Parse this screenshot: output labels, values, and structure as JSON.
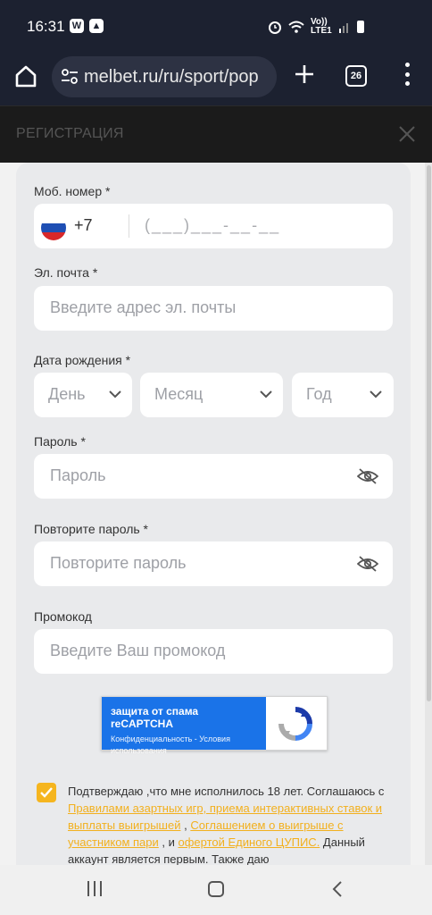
{
  "status_bar": {
    "time": "16:31",
    "left_icons": [
      "whatsapp-icon",
      "gallery-icon"
    ],
    "network_label": "Vo)) LTE1",
    "right_icons": [
      "alarm-icon",
      "wifi-icon",
      "signal-icon",
      "battery-icon"
    ]
  },
  "browser": {
    "url": "melbet.ru/ru/sport/pop",
    "tab_count": "26"
  },
  "modal": {
    "title": "РЕГИСТРАЦИЯ"
  },
  "form": {
    "phone": {
      "label": "Моб. номер *",
      "country_code": "+7",
      "placeholder": "(___)___-__-__"
    },
    "email": {
      "label": "Эл. почта *",
      "placeholder": "Введите адрес эл. почты"
    },
    "birth_date": {
      "label": "Дата рождения *",
      "day": "День",
      "month": "Месяц",
      "year": "Год"
    },
    "password": {
      "label": "Пароль *",
      "placeholder": "Пароль"
    },
    "password_repeat": {
      "label": "Повторите пароль *",
      "placeholder": "Повторите пароль"
    },
    "promo": {
      "label": "Промокод",
      "placeholder": "Введите Ваш промокод"
    }
  },
  "captcha": {
    "title": "защита от спама reCAPTCHA",
    "privacy": "Конфиденциальность",
    "separator": " - ",
    "terms": "Условия использования"
  },
  "consent": {
    "checked": true,
    "text_1": "Подтверждаю ,что мне исполнилось 18 лет. Соглашаюсь с ",
    "link_1": "Правилами азартных игр, приема интерактивных ставок и выплаты выигрышей",
    "text_2": " , ",
    "link_2": "Соглашением о выигрыше с участником пари",
    "text_3": " , и ",
    "link_3": "офертой Единого ЦУПИС.",
    "text_4": " Данный аккаунт является первым. Также даю"
  },
  "colors": {
    "accent": "#f5b51f",
    "captcha_blue": "#1a73e8",
    "top_bar": "#1c2130"
  }
}
